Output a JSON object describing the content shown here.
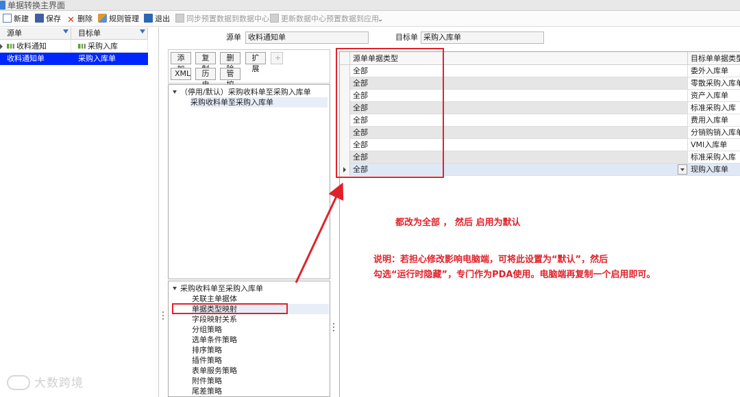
{
  "window": {
    "title": "单据转换主界面"
  },
  "toolbar": {
    "new_label": "新建",
    "save_label": "保存",
    "delete_label": "删除",
    "rule_manage_label": "规则管理",
    "exit_label": "退出",
    "sync_label": "同步预置数据到数据中心",
    "update_label": "更新数据中心预置数据到应用"
  },
  "left_grid": {
    "columns": [
      "源单",
      "目标单"
    ],
    "rows": [
      {
        "source": "收料通知",
        "target": "采购入库",
        "node": true,
        "selected": false
      },
      {
        "source": "收料通知单",
        "target": "采购入库单",
        "node": false,
        "selected": true
      }
    ]
  },
  "form": {
    "source_label": "源单",
    "source_value": "收料通知单",
    "target_label": "目标单",
    "target_value": "采购入库单"
  },
  "buttons": {
    "add": "添加",
    "copy": "复制",
    "delete": "删除",
    "extend": "扩展",
    "plus": "+",
    "xml": "XML",
    "history": "历史",
    "control": "管控"
  },
  "rule_tree": {
    "root": "（停用/默认）采购收料单至采购入库单",
    "child": "采购收料单至采购入库单"
  },
  "policy_tree": {
    "root": "采购收料单至采购入库单",
    "items": [
      "关联主单据体",
      "单据类型映射",
      "字段映射关系",
      "分组策略",
      "选单条件策略",
      "排序策略",
      "插件策略",
      "表单服务策略",
      "附件策略",
      "尾差策略"
    ],
    "selected_index": 1
  },
  "mapping_grid": {
    "columns": [
      "源单单据类型",
      "目标单单据类型"
    ],
    "rows": [
      {
        "source": "全部",
        "target": "委外入库单"
      },
      {
        "source": "全部",
        "target": "零散采购入库单"
      },
      {
        "source": "全部",
        "target": "资产入库单"
      },
      {
        "source": "全部",
        "target": "标准采购入库"
      },
      {
        "source": "全部",
        "target": "费用入库单"
      },
      {
        "source": "全部",
        "target": "分销购销入库单"
      },
      {
        "source": "全部",
        "target": "VMI入库单"
      },
      {
        "source": "全部",
        "target": "标准采购入库"
      },
      {
        "source": "全部",
        "target": "现购入库单"
      }
    ]
  },
  "annotations": {
    "note1": "都改为全部 ， 然后 启用为默认",
    "note2_line1": "说明：若担心修改影响电脑端，可将此设置为“默认”，然后",
    "note2_line2": "勾选“运行时隐藏”，专门作为PDA使用。电脑端再复制一个启用即可。",
    "color": "#e0212a"
  },
  "watermark": "大数跨境"
}
